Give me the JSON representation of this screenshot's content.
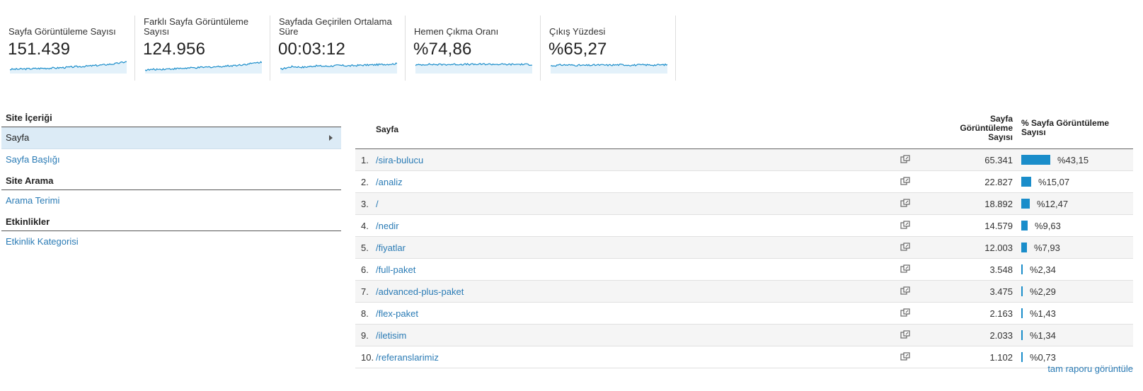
{
  "metrics": [
    {
      "label": "Sayfa Görüntüleme Sayısı",
      "value": "151.439"
    },
    {
      "label": "Farklı Sayfa Görüntüleme Sayısı",
      "value": "124.956"
    },
    {
      "label": "Sayfada Geçirilen Ortalama Süre",
      "value": "00:03:12"
    },
    {
      "label": "Hemen Çıkma Oranı",
      "value": "%74,86"
    },
    {
      "label": "Çıkış Yüzdesi",
      "value": "%65,27"
    }
  ],
  "nav": {
    "site_content_heading": "Site İçeriği",
    "page_item": "Sayfa",
    "page_title_item": "Sayfa Başlığı",
    "site_search_heading": "Site Arama",
    "search_term_item": "Arama Terimi",
    "events_heading": "Etkinlikler",
    "event_category_item": "Etkinlik Kategorisi"
  },
  "table": {
    "col_page": "Sayfa",
    "col_views": "Sayfa Görüntüleme Sayısı",
    "col_pct": "% Sayfa Görüntüleme Sayısı",
    "rows": [
      {
        "idx": "1.",
        "page": "/sira-bulucu",
        "views": "65.341",
        "pct": "%43,15",
        "share": 43.15
      },
      {
        "idx": "2.",
        "page": "/analiz",
        "views": "22.827",
        "pct": "%15,07",
        "share": 15.07
      },
      {
        "idx": "3.",
        "page": "/",
        "views": "18.892",
        "pct": "%12,47",
        "share": 12.47
      },
      {
        "idx": "4.",
        "page": "/nedir",
        "views": "14.579",
        "pct": "%9,63",
        "share": 9.63
      },
      {
        "idx": "5.",
        "page": "/fiyatlar",
        "views": "12.003",
        "pct": "%7,93",
        "share": 7.93
      },
      {
        "idx": "6.",
        "page": "/full-paket",
        "views": "3.548",
        "pct": "%2,34",
        "share": 2.34
      },
      {
        "idx": "7.",
        "page": "/advanced-plus-paket",
        "views": "3.475",
        "pct": "%2,29",
        "share": 2.29
      },
      {
        "idx": "8.",
        "page": "/flex-paket",
        "views": "2.163",
        "pct": "%1,43",
        "share": 1.43
      },
      {
        "idx": "9.",
        "page": "/iletisim",
        "views": "2.033",
        "pct": "%1,34",
        "share": 1.34
      },
      {
        "idx": "10.",
        "page": "/referanslarimiz",
        "views": "1.102",
        "pct": "%0,73",
        "share": 0.73
      }
    ],
    "full_report_link": "tam raporu görüntüle"
  },
  "colors": {
    "accent": "#1a8dca",
    "link": "#2a7bb5",
    "selected_bg": "#dcebf6"
  }
}
